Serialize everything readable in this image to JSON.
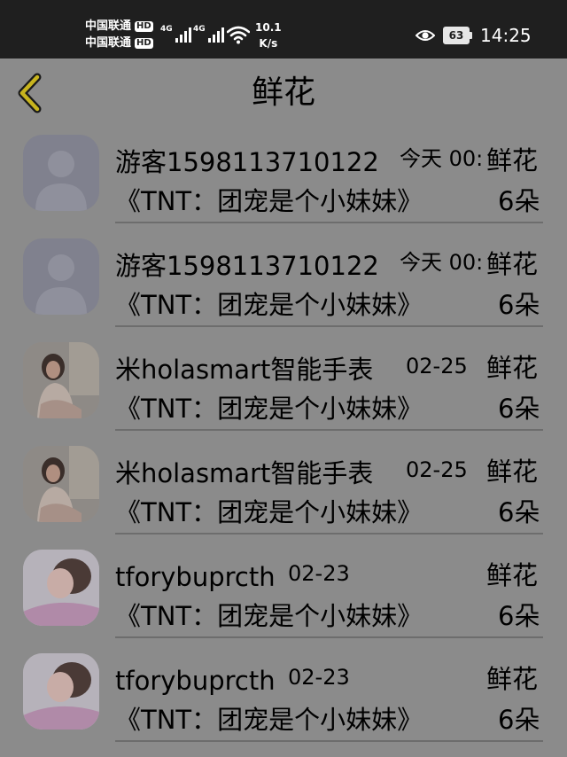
{
  "status_bar": {
    "carrier_1": "中国联通",
    "carrier_2": "中国联通",
    "hd_1": "HD",
    "hd_2": "HD",
    "signal_1_tag": "4G",
    "signal_2_tag": "4G",
    "net_speed_value": "10.1",
    "net_speed_unit": "K/s",
    "battery": "63",
    "time": "14:25"
  },
  "header": {
    "title": "鲜花"
  },
  "colors": {
    "back_arrow": "#c8b41e",
    "overlay_background": "#8b8b8b"
  },
  "list": [
    {
      "name": "游客1598113710122",
      "time": "今天 00:",
      "gift": "鲜花",
      "work": "《TNT：团宠是个小妹妹》",
      "count": "6朵",
      "avatar": "default-avatar-icon"
    },
    {
      "name": "游客1598113710122",
      "time": "今天 00:",
      "gift": "鲜花",
      "work": "《TNT：团宠是个小妹妹》",
      "count": "6朵",
      "avatar": "default-avatar-icon"
    },
    {
      "name": "米holasmart智能手表",
      "time": "02-25",
      "gift": "鲜花",
      "work": "《TNT：团宠是个小妹妹》",
      "count": "6朵",
      "avatar": "user-photo"
    },
    {
      "name": "米holasmart智能手表",
      "time": "02-25",
      "gift": "鲜花",
      "work": "《TNT：团宠是个小妹妹》",
      "count": "6朵",
      "avatar": "user-photo"
    },
    {
      "name": "tforybuprcth",
      "time": "02-23",
      "gift": "鲜花",
      "work": "《TNT：团宠是个小妹妹》",
      "count": "6朵",
      "avatar": "user-photo"
    },
    {
      "name": "tforybuprcth",
      "time": "02-23",
      "gift": "鲜花",
      "work": "《TNT：团宠是个小妹妹》",
      "count": "6朵",
      "avatar": "user-photo"
    }
  ]
}
